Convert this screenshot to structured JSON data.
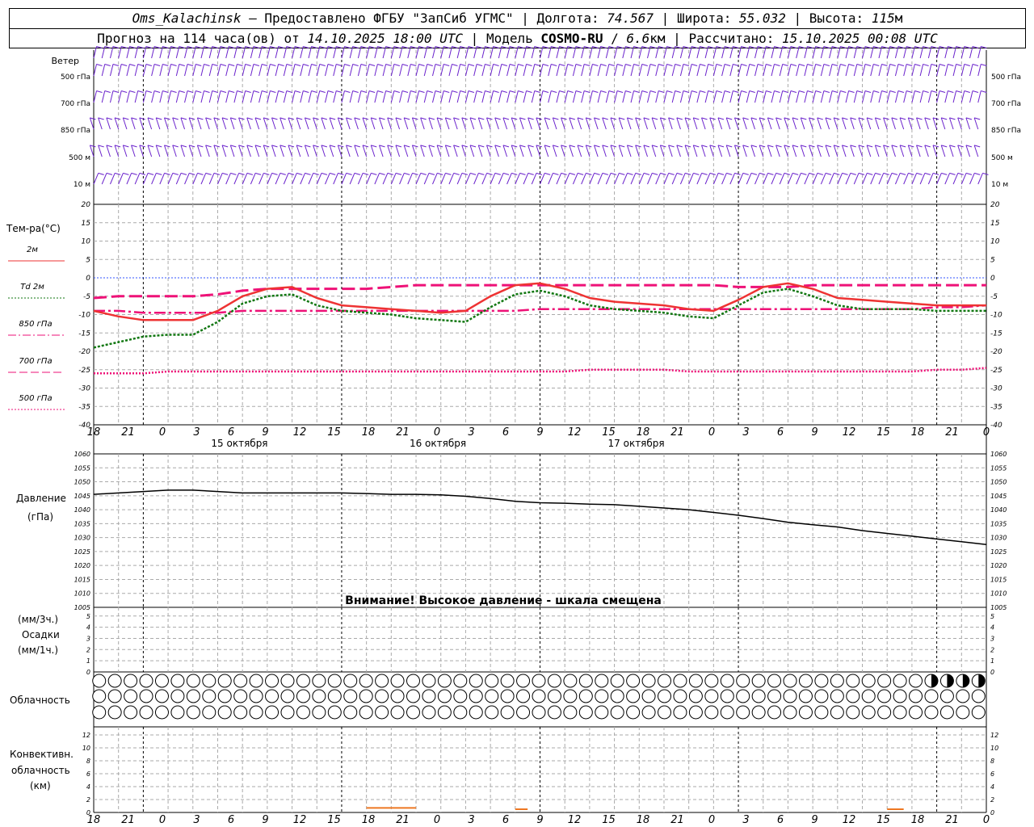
{
  "header": {
    "station": "Oms_Kalachinsk",
    "provider": "— Предоставлено ФГБУ \"ЗапСиб УГМС\"",
    "lon_label": "Долгота:",
    "lon": "74.567",
    "lat_label": "Широта:",
    "lat": "55.032",
    "alt_label": "Высота:",
    "alt": "115",
    "alt_unit": "м",
    "forecast_label": "Прогноз на 114 часа(ов) от",
    "forecast_start": "14.10.2025 18:00 UTC",
    "model_label": "Модель",
    "model": "COSMO-RU",
    "resolution": "6.6",
    "resolution_unit": "км",
    "computed_label": "Рассчитано:",
    "computed": "15.10.2025 00:08 UTC"
  },
  "time_axis": {
    "ticks": [
      "18",
      "21",
      "0",
      "3",
      "6",
      "9",
      "12",
      "15",
      "18",
      "21",
      "0",
      "3",
      "6",
      "9",
      "12",
      "15",
      "18",
      "21",
      "0",
      "3",
      "6",
      "9",
      "12",
      "15",
      "18",
      "21",
      "0"
    ],
    "day_labels": [
      "15 октября",
      "16 октября",
      "17 октября"
    ]
  },
  "wind_panel": {
    "title": "Ветер",
    "levels": [
      "500 гПа",
      "700 гПа",
      "850 гПа",
      "500 м",
      "10  м"
    ]
  },
  "temp_panel": {
    "title": "Тем-ра(°C)",
    "legend": [
      {
        "label": "2м",
        "color": "#ee3333",
        "style": "solid"
      },
      {
        "label": "Td  2м",
        "color": "#117711",
        "style": "dotted"
      },
      {
        "label": "850 гПа",
        "color": "#ee1177",
        "style": "dashdot"
      },
      {
        "label": "700 гПа",
        "color": "#ee1177",
        "style": "longdash"
      },
      {
        "label": "500 гПа",
        "color": "#ee1177",
        "style": "dot"
      }
    ],
    "yticks": [
      "20",
      "15",
      "10",
      "5",
      "0",
      "-5",
      "-10",
      "-15",
      "-20",
      "-25",
      "-30",
      "-35",
      "-40"
    ]
  },
  "pressure_panel": {
    "title": "Давление",
    "unit": "(гПа)",
    "warning": "Внимание! Высокое давление - шкала смещена",
    "yticks": [
      "1060",
      "1055",
      "1050",
      "1045",
      "1040",
      "1035",
      "1030",
      "1025",
      "1020",
      "1015",
      "1010",
      "1005"
    ]
  },
  "precip_panel": {
    "unit_top": "(мм/3ч.)",
    "title": "Осадки",
    "unit_bottom": "(мм/1ч.)",
    "yticks": [
      "5",
      "4",
      "3",
      "2",
      "1",
      "0"
    ]
  },
  "cloud_panel": {
    "title": "Облачность"
  },
  "conv_panel": {
    "title_1": "Конвективн.",
    "title_2": "облачность",
    "unit": "(км)",
    "yticks": [
      "12",
      "10",
      "8",
      "6",
      "4",
      "2",
      "0"
    ]
  },
  "chart_data": {
    "type": "line",
    "x_hours": [
      0,
      3,
      6,
      9,
      12,
      15,
      18,
      21,
      24,
      27,
      30,
      33,
      36,
      39,
      42,
      45,
      48,
      51,
      54,
      57,
      60,
      63,
      66,
      69,
      72,
      75,
      78,
      81,
      84,
      87,
      90,
      93,
      96,
      99,
      102,
      105,
      108
    ],
    "temperature": {
      "ylim": [
        -40,
        20
      ],
      "series": [
        {
          "name": "2м",
          "values": [
            -9,
            -10.5,
            -11.5,
            -11.5,
            -11.5,
            -9,
            -5,
            -3,
            -2.5,
            -5.5,
            -7.5,
            -8,
            -8.5,
            -9,
            -9.5,
            -9,
            -5,
            -2,
            -1.5,
            -3,
            -5.5,
            -6.5,
            -7,
            -7.5,
            -8.5,
            -9,
            -6,
            -2.5,
            -1.5,
            -3,
            -5.5,
            -6,
            -6.5,
            -7,
            -7.5,
            -7.5,
            -7.5
          ]
        },
        {
          "name": "Td  2м",
          "values": [
            -19,
            -17.5,
            -16,
            -15.5,
            -15.5,
            -12,
            -7,
            -5,
            -4.5,
            -7.5,
            -9,
            -9.5,
            -10,
            -11,
            -11.5,
            -12,
            -8,
            -4.5,
            -3.5,
            -5,
            -7.5,
            -8.5,
            -9,
            -9.5,
            -10.5,
            -11,
            -7.5,
            -4,
            -3,
            -5,
            -7.5,
            -8.5,
            -8.5,
            -8.5,
            -9,
            -9,
            -9
          ]
        },
        {
          "name": "850 гПа",
          "values": [
            -9,
            -9,
            -9.5,
            -9.5,
            -9.5,
            -9.5,
            -9,
            -9,
            -9,
            -9,
            -9,
            -9,
            -9,
            -9,
            -9,
            -9,
            -9,
            -9,
            -8.5,
            -8.5,
            -8.5,
            -8.5,
            -8.5,
            -8.5,
            -8.5,
            -8.5,
            -8.5,
            -8.5,
            -8.5,
            -8.5,
            -8.5,
            -8.5,
            -8.5,
            -8.5,
            -8,
            -8,
            -7.5
          ]
        },
        {
          "name": "700 гПа",
          "values": [
            -5.5,
            -5,
            -5,
            -5,
            -5,
            -4.5,
            -3.5,
            -3,
            -3,
            -3,
            -3,
            -3,
            -2.5,
            -2,
            -2,
            -2,
            -2,
            -2,
            -2,
            -2,
            -2,
            -2,
            -2,
            -2,
            -2,
            -2,
            -2.5,
            -2.5,
            -2.5,
            -2,
            -2,
            -2,
            -2,
            -2,
            -2,
            -2,
            -2
          ]
        },
        {
          "name": "500 гПа",
          "values": [
            -26,
            -26,
            -26,
            -25.5,
            -25.5,
            -25.5,
            -25.5,
            -25.5,
            -25.5,
            -25.5,
            -25.5,
            -25.5,
            -25.5,
            -25.5,
            -25.5,
            -25.5,
            -25.5,
            -25.5,
            -25.5,
            -25.5,
            -25,
            -25,
            -25,
            -25,
            -25.5,
            -25.5,
            -25.5,
            -25.5,
            -25.5,
            -25.5,
            -25.5,
            -25.5,
            -25.5,
            -25.5,
            -25,
            -25,
            -24.5
          ]
        }
      ]
    },
    "pressure": {
      "ylim": [
        1005,
        1060
      ],
      "values": [
        1045.5,
        1046,
        1046.5,
        1047,
        1047,
        1046.5,
        1046,
        1046,
        1046,
        1046,
        1046,
        1045.8,
        1045.5,
        1045.5,
        1045.3,
        1044.8,
        1044,
        1043,
        1042.5,
        1042.3,
        1042,
        1041.8,
        1041.2,
        1040.6,
        1040,
        1039,
        1038,
        1036.8,
        1035.5,
        1034.6,
        1033.8,
        1032.5,
        1031.5,
        1030.5,
        1029.5,
        1028.5,
        1027.5
      ]
    },
    "precipitation": {
      "ylim": [
        0,
        5
      ],
      "values": []
    },
    "convective_cloud_km": {
      "ylim": [
        0,
        13
      ],
      "bars": [
        {
          "from_hour": 33,
          "to_hour": 39,
          "km": 0.7
        },
        {
          "from_hour": 51,
          "to_hour": 52.5,
          "km": 0.5
        },
        {
          "from_hour": 96,
          "to_hour": 98,
          "km": 0.5
        }
      ]
    },
    "cloudiness": {
      "rows": 3,
      "per_row": 57,
      "top_row_partial_last": 4
    }
  }
}
